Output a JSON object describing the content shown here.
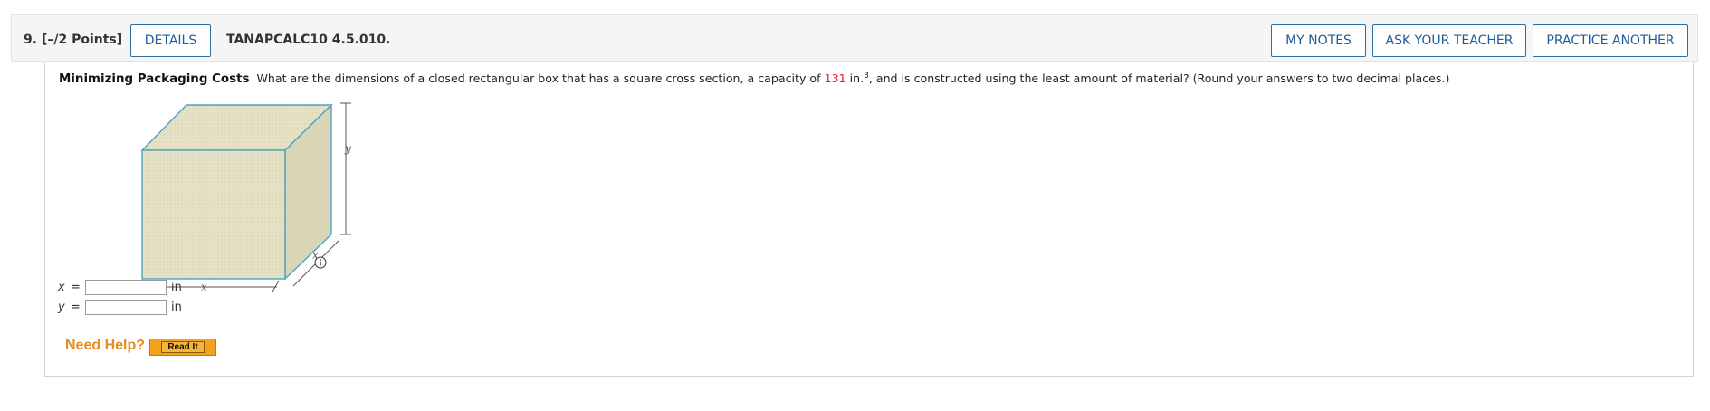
{
  "header": {
    "question_number": "9.",
    "points": "[–/2 Points]",
    "details_label": "DETAILS",
    "code": "TANAPCALC10 4.5.010.",
    "my_notes_label": "MY NOTES",
    "ask_teacher_label": "ASK YOUR TEACHER",
    "practice_another_label": "PRACTICE ANOTHER"
  },
  "problem": {
    "title": "Minimizing Packaging Costs",
    "text_before": "What are the dimensions of a closed rectangular box that has a square cross section, a capacity of ",
    "capacity": "131",
    "unit": "in.",
    "unit_exp": "3",
    "text_after": ", and is constructed using the least amount of material? (Round your answers to two decimal places.)"
  },
  "figure": {
    "label_x_bottom": "x",
    "label_x_side": "x",
    "label_y": "y"
  },
  "answers": [
    {
      "var": "x",
      "eq": "=",
      "value": "",
      "unit": "in"
    },
    {
      "var": "y",
      "eq": "=",
      "value": "",
      "unit": "in"
    }
  ],
  "help": {
    "need_help_label": "Need Help?",
    "read_it_label": "Read It"
  }
}
